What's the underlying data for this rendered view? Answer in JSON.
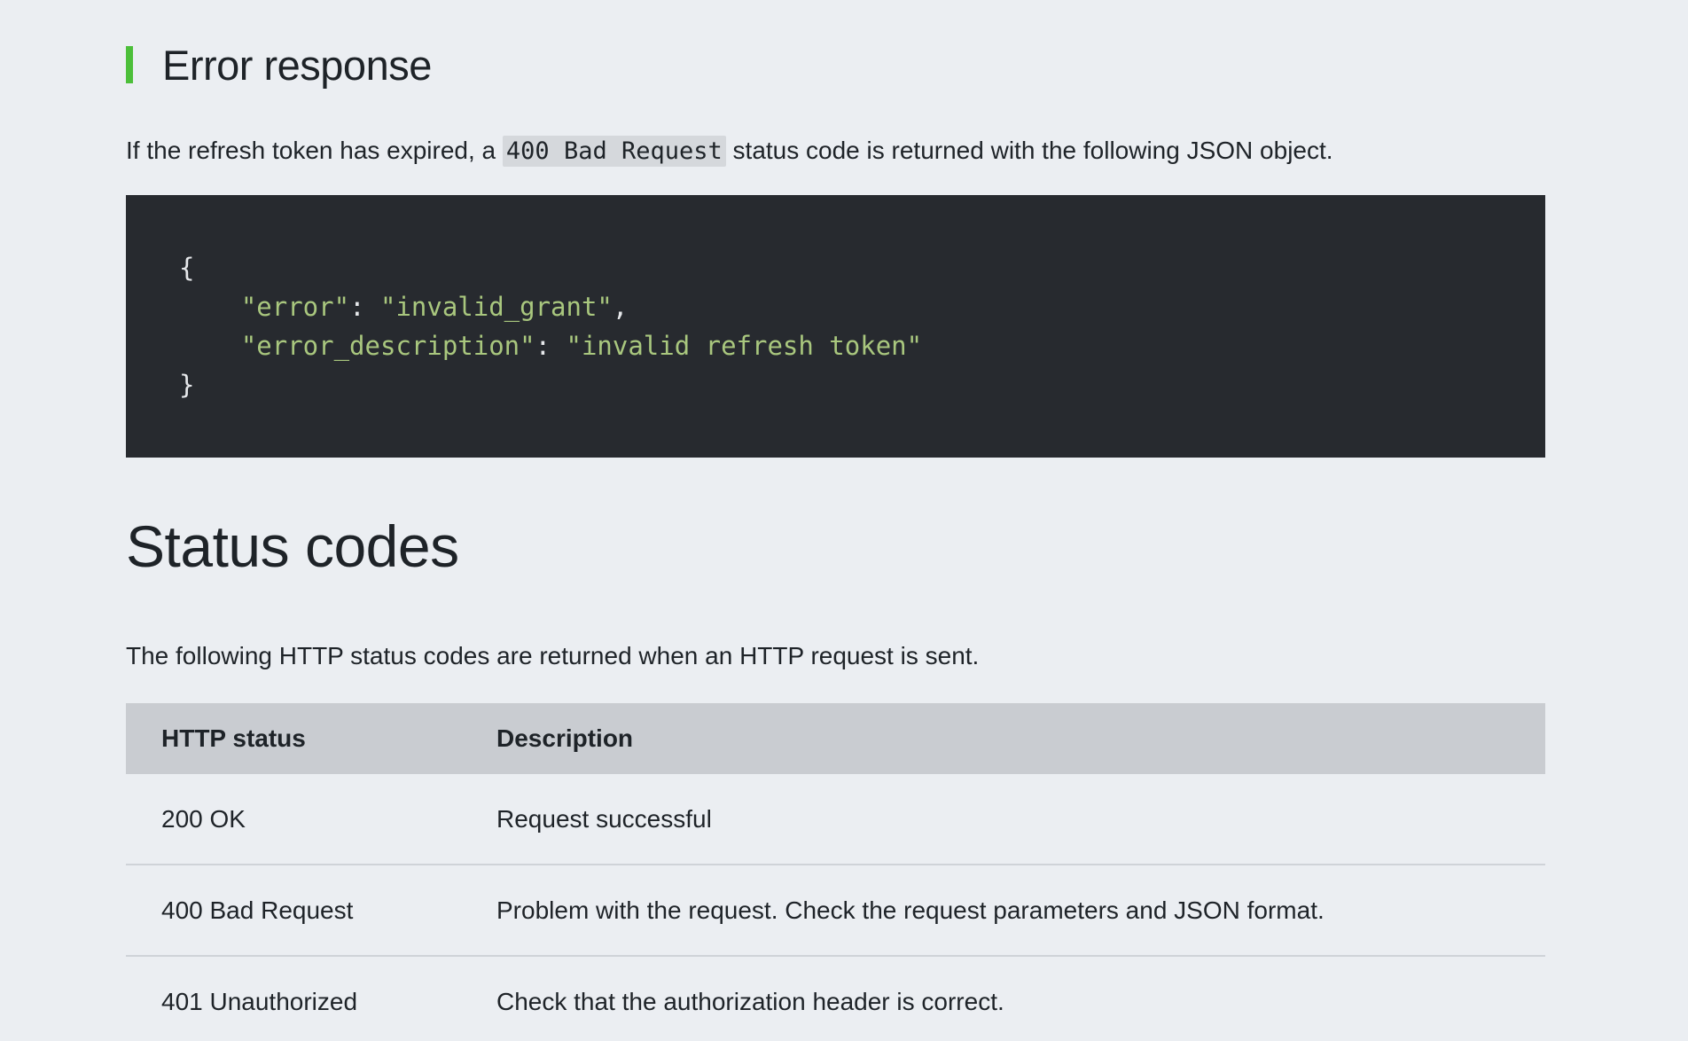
{
  "error_section": {
    "heading": "Error response",
    "intro_before": "If the refresh token has expired, a ",
    "intro_code": "400 Bad Request",
    "intro_after": " status code is returned with the following JSON object.",
    "accent_color": "#4cbf3a"
  },
  "code_block": {
    "open_brace": "{",
    "line1_key": "\"error\"",
    "line1_sep": ": ",
    "line1_value": "\"invalid_grant\"",
    "line1_trail": ",",
    "line2_key": "\"error_description\"",
    "line2_sep": ": ",
    "line2_value": "\"invalid refresh token\"",
    "close_brace": "}",
    "background": "#272a2f",
    "string_color": "#a9c77e"
  },
  "status_section": {
    "heading": "Status codes",
    "intro": "The following HTTP status codes are returned when an HTTP request is sent.",
    "columns": [
      "HTTP status",
      "Description"
    ],
    "rows": [
      {
        "status": "200 OK",
        "description": "Request successful"
      },
      {
        "status": "400 Bad Request",
        "description": "Problem with the request. Check the request parameters and JSON format."
      },
      {
        "status": "401 Unauthorized",
        "description": "Check that the authorization header is correct."
      }
    ]
  }
}
